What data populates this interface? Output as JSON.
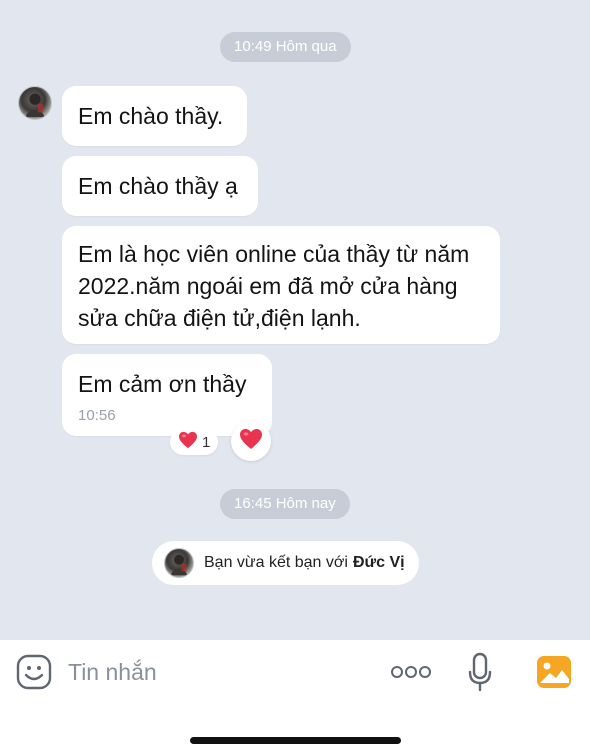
{
  "chat": {
    "date_pill_1": "10:49 Hôm qua",
    "messages": [
      {
        "text": "Em chào thầy."
      },
      {
        "text": "Em chào thầy ạ"
      },
      {
        "text": "Em là học viên online của thầy từ năm\n2022.năm ngoái em đã mở cửa hàng\nsửa chữa điện tử,điện lạnh."
      },
      {
        "text": "Em cảm ơn thầy",
        "time": "10:56"
      }
    ],
    "reaction": {
      "icon": "heart-icon",
      "count": "1"
    },
    "date_pill_2": "16:45 Hôm nay",
    "friend_notice": {
      "prefix": "Bạn vừa kết bạn với",
      "name": "Đức Vị"
    }
  },
  "composer": {
    "placeholder": "Tin nhắn",
    "icons": [
      "emoji-icon",
      "more-icon",
      "microphone-icon",
      "image-icon"
    ]
  },
  "colors": {
    "background": "#e2e6ef",
    "bubble": "#ffffff",
    "pill": "#c7ccd6",
    "heart": "#e8344e",
    "image_icon": "#f5a623"
  }
}
